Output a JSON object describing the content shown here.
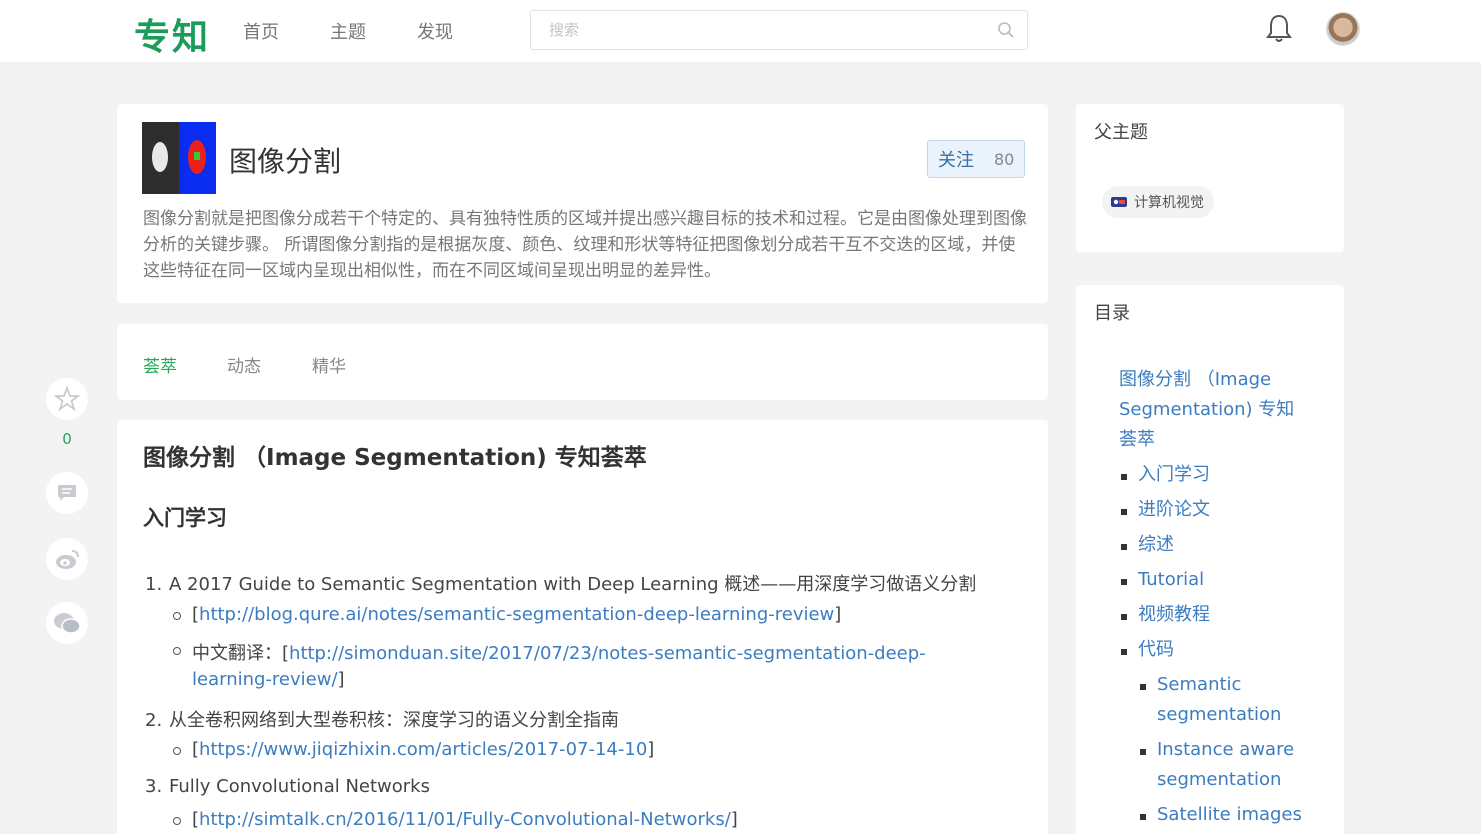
{
  "header": {
    "logo": "专知",
    "nav": [
      "首页",
      "主题",
      "发现"
    ],
    "search_placeholder": "搜索"
  },
  "topic": {
    "title": "图像分割",
    "follow_label": "关注",
    "follow_count": "80",
    "description": "图像分割就是把图像分成若干个特定的、具有独特性质的区域并提出感兴趣目标的技术和过程。它是由图像处理到图像分析的关键步骤。 所谓图像分割指的是根据灰度、颜色、纹理和形状等特征把图像划分成若干互不交迭的区域，并使这些特征在同一区域内呈现出相似性，而在不同区域间呈现出明显的差异性。"
  },
  "tabs": [
    "荟萃",
    "动态",
    "精华"
  ],
  "side_actions": {
    "like_count": "0"
  },
  "article": {
    "title": "图像分割 （Image Segmentation) 专知荟萃",
    "section": "入门学习",
    "items": [
      {
        "num": "1.",
        "text": "A 2017 Guide to Semantic Segmentation with Deep Learning 概述——用深度学习做语义分割",
        "sub": [
          {
            "prefix": "",
            "link": "http://blog.qure.ai/notes/semantic-segmentation-deep-learning-review"
          },
          {
            "prefix": "中文翻译：",
            "link_line1": "http://simonduan.site/2017/07/23/notes-semantic-segmentation-deep-",
            "link_line2": "learning-review/"
          }
        ]
      },
      {
        "num": "2.",
        "text": "从全卷积网络到大型卷积核：深度学习的语义分割全指南",
        "sub": [
          {
            "prefix": "",
            "link": "https://www.jiqizhixin.com/articles/2017-07-14-10"
          }
        ]
      },
      {
        "num": "3.",
        "text": "Fully Convolutional Networks",
        "sub": [
          {
            "prefix": "",
            "link": "http://simtalk.cn/2016/11/01/Fully-Convolutional-Networks/"
          }
        ]
      }
    ]
  },
  "sidebar": {
    "parent_heading": "父主题",
    "parent_topic": "计算机视觉",
    "toc_heading": "目录",
    "toc_title_lines": [
      "图像分割 （Image",
      "Segmentation) 专知",
      "荟萃"
    ],
    "toc_items": [
      "入门学习",
      "进阶论文",
      "综述",
      "Tutorial",
      "视频教程",
      "代码"
    ],
    "toc_sub_items": [
      [
        "Semantic",
        "segmentation"
      ],
      [
        "Instance aware",
        "segmentation"
      ],
      [
        "Satellite images"
      ]
    ]
  }
}
